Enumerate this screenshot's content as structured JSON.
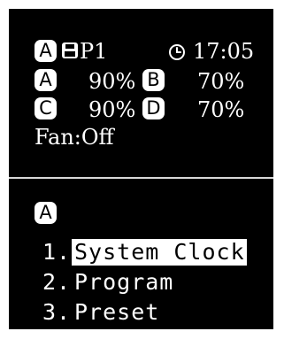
{
  "status": {
    "channel_badge": "A",
    "preset": "P1",
    "time": "17:05",
    "icons": {
      "save": "floppy-disk-icon",
      "clock": "clock-icon"
    }
  },
  "channels": [
    {
      "badge": "A",
      "value": "90%"
    },
    {
      "badge": "B",
      "value": "70%"
    },
    {
      "badge": "C",
      "value": "90%"
    },
    {
      "badge": "D",
      "value": "70%"
    }
  ],
  "fan": {
    "text": "Fan:Off"
  },
  "menu": {
    "channel_badge": "A",
    "items": [
      {
        "number": "1.",
        "label": "System Clock",
        "selected": true
      },
      {
        "number": "2.",
        "label": "Program",
        "selected": false
      },
      {
        "number": "3.",
        "label": "Preset",
        "selected": false
      }
    ]
  },
  "colors": {
    "background": "#000000",
    "foreground": "#ffffff",
    "page": "#ffffff"
  }
}
